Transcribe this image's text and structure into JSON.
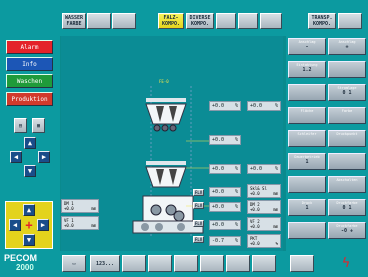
{
  "top_buttons": [
    {
      "label": "",
      "active": false
    },
    {
      "label": "WASSER\nFARBE",
      "active": false
    },
    {
      "label": "",
      "active": false
    },
    {
      "label": "",
      "active": false
    },
    {
      "label": "FALZ-\nKOMPO.",
      "active": true
    },
    {
      "label": "DIVERSE\nKOMPO.",
      "active": false
    },
    {
      "label": "",
      "active": false
    },
    {
      "label": "",
      "active": false
    },
    {
      "label": "",
      "active": false
    },
    {
      "label": "TRANSP.\nKOMPO.",
      "active": false
    },
    {
      "label": "",
      "active": false
    }
  ],
  "modes": {
    "alarm": "Alarm",
    "info": "Info",
    "waschen": "Waschen",
    "produktion": "Produktion"
  },
  "colors": {
    "alarm": "#e4232a",
    "info": "#1c56b6",
    "waschen": "#1f9b3a",
    "produktion": "#d23a2c"
  },
  "center": {
    "top_label": "FE-0",
    "v1": "+0.0",
    "v2": "+0.0",
    "v3": "+0.0",
    "v4": "+0.0",
    "v5": "+0.0",
    "v6": "+0.0",
    "v7": "+0.0",
    "v8": "+0.0",
    "v9": "+0.0",
    "unit_pct": "%",
    "unit_mm": "mm",
    "skl_label": "Skl& Sl",
    "dm_label": "DM 2",
    "vf_label": "VF 2",
    "dm1_label": "DM 1",
    "vf1_label": "VF 1",
    "pkt_label": "PKT",
    "pkt_value": "-0.7",
    "flv": "FLV"
  },
  "right_panel": [
    {
      "title": "Anschlag",
      "value": "-"
    },
    {
      "title": "Anschlag",
      "value": "+"
    },
    {
      "title": "Eintaktung",
      "value": "1.2"
    },
    {
      "title": "",
      "value": ""
    },
    {
      "title": "",
      "value": ""
    },
    {
      "title": "Stromlage",
      "value": "0 1"
    },
    {
      "title": "Fläche",
      "value": ""
    },
    {
      "title": "Farbe",
      "value": ""
    },
    {
      "title": "Schleifer",
      "value": ""
    },
    {
      "title": "Druckpunkt",
      "value": ""
    },
    {
      "title": "Dauerbetrieb",
      "value": "1"
    },
    {
      "title": "",
      "value": ""
    },
    {
      "title": "",
      "value": ""
    },
    {
      "title": "Abschalten",
      "value": ""
    },
    {
      "title": "Druck",
      "value": "1"
    },
    {
      "title": "Druckfarbe",
      "value": "0 1"
    },
    {
      "title": "",
      "value": ""
    },
    {
      "title": "Druckfarbe",
      "value": "-0 +"
    }
  ],
  "logo": {
    "brand": "PECOM",
    "year": "2000"
  },
  "bottom": {
    "counter": "123..."
  }
}
